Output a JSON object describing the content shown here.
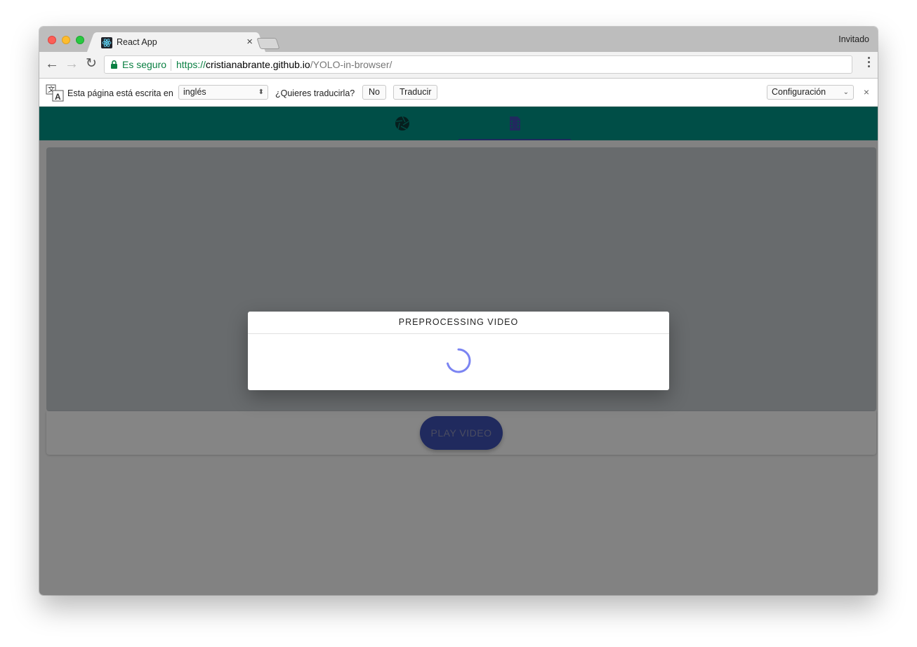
{
  "browser": {
    "tab": {
      "title": "React App",
      "close_glyph": "×",
      "favicon": "react-logo-icon"
    },
    "profile": "Invitado",
    "nav": {
      "back_glyph": "←",
      "forward_glyph": "→",
      "reload_glyph": "↻"
    },
    "omnibox": {
      "secure_label": "Es seguro",
      "url_scheme": "https://",
      "url_host": "cristianabrante.github.io",
      "url_path": "/YOLO-in-browser/"
    }
  },
  "translate_bar": {
    "message": "Esta página está escrita en",
    "language": "inglés",
    "question": "¿Quieres traducirla?",
    "no_label": "No",
    "translate_label": "Traducir",
    "settings_label": "Configuración",
    "close_glyph": "×"
  },
  "app": {
    "colors": {
      "appbar": "#009688",
      "indicator": "#3f51b5",
      "button": "#3f51b5"
    },
    "tabs": [
      {
        "icon": "camera-aperture-icon",
        "active": false
      },
      {
        "icon": "video-file-icon",
        "active": true
      }
    ],
    "play_button": "PLAY VIDEO",
    "dialog": {
      "title": "PREPROCESSING VIDEO"
    }
  }
}
